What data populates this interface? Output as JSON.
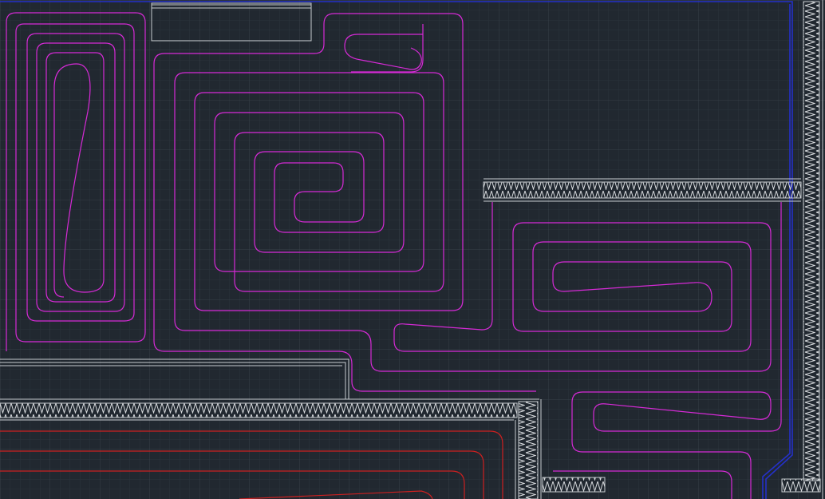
{
  "app": {
    "view": "floor-heating-layout-plan"
  },
  "colors": {
    "background": "#212830",
    "grid_minor": "#2b333c",
    "grid_major": "#364049",
    "heating_loop": "#d62ad6",
    "heating_loop_secondary": "#cc2020",
    "wall_outline": "#c8ccd0",
    "insulation_hatch": "#d8dbde",
    "boundary": "#2430c8"
  },
  "layers": [
    {
      "name": "heating-loop-magenta",
      "color": "#d62ad6"
    },
    {
      "name": "heating-loop-red",
      "color": "#cc2020"
    },
    {
      "name": "walls",
      "color": "#c8ccd0"
    },
    {
      "name": "insulation",
      "color": "#d8dbde"
    },
    {
      "name": "boundary",
      "color": "#2430c8"
    }
  ]
}
